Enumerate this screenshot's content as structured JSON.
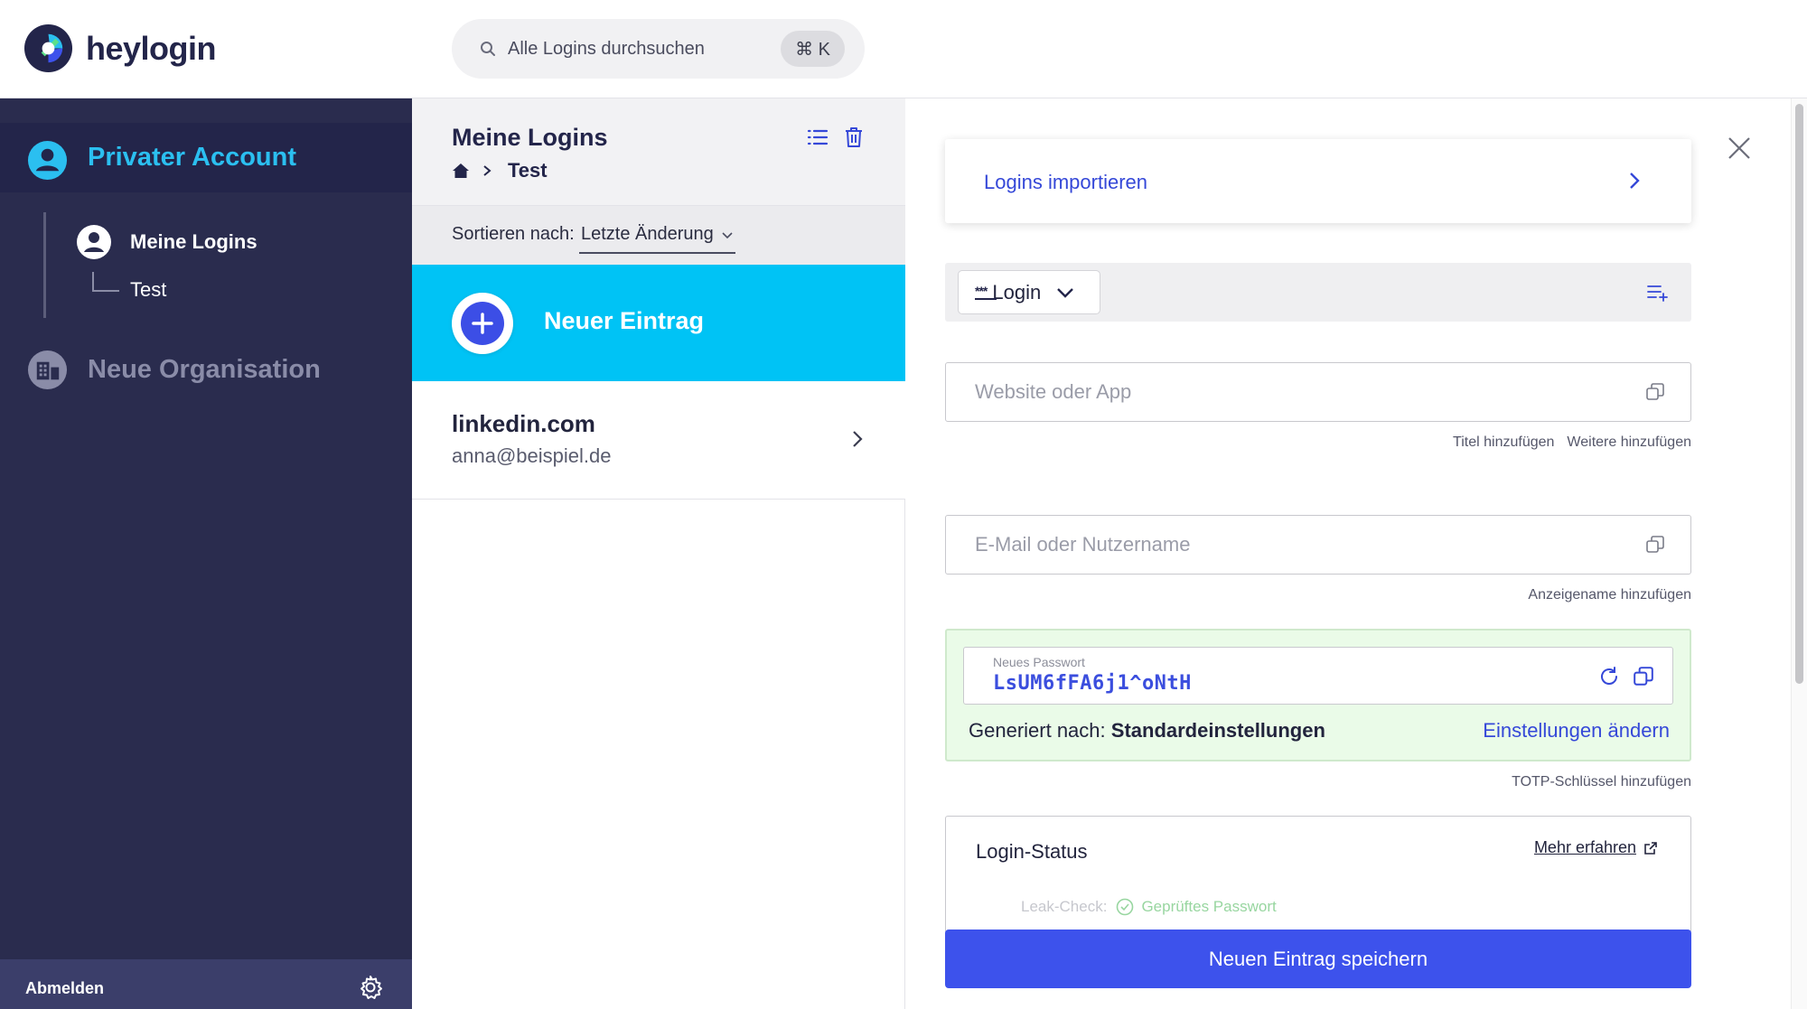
{
  "brand": {
    "name": "heylogin"
  },
  "search": {
    "placeholder": "Alle Logins durchsuchen",
    "shortcut": "⌘ K"
  },
  "sidebar": {
    "account": "Privater Account",
    "tree": {
      "logins": "Meine Logins",
      "sub": "Test"
    },
    "organisation": "Neue Organisation",
    "logout": "Abmelden"
  },
  "list": {
    "title": "Meine Logins",
    "breadcrumb": "Test",
    "sort_label": "Sortieren nach:",
    "sort_value": "Letzte Änderung",
    "new_entry": "Neuer Eintrag",
    "items": [
      {
        "site": "linkedin.com",
        "user": "anna@beispiel.de"
      }
    ]
  },
  "detail": {
    "import": "Logins importieren",
    "type": {
      "dots": "***",
      "label": "Login"
    },
    "website_placeholder": "Website oder App",
    "website_hints": [
      "Titel hinzufügen",
      "Weitere hinzufügen"
    ],
    "email_placeholder": "E-Mail oder Nutzername",
    "email_hint": "Anzeigename hinzufügen",
    "password": {
      "caption": "Neues Passwort",
      "value": "LsUM6fFA6j1^oNtH",
      "generated_prefix": "Generiert nach:",
      "generated_value": "Standardeinstellungen",
      "settings_link": "Einstellungen ändern"
    },
    "totp_hint": "TOTP-Schlüssel hinzufügen",
    "status": {
      "title": "Login-Status",
      "more": "Mehr erfahren",
      "leak_label": "Leak-Check:",
      "leak_value": "Geprüftes Passwort"
    },
    "save": "Neuen Eintrag speichern"
  },
  "colors": {
    "sidebar_bg": "#2a2c4e",
    "accent_cyan": "#00c3f5",
    "primary_blue": "#3d52ec",
    "link_blue": "#3548d8",
    "password_bg": "#eafbe8"
  }
}
